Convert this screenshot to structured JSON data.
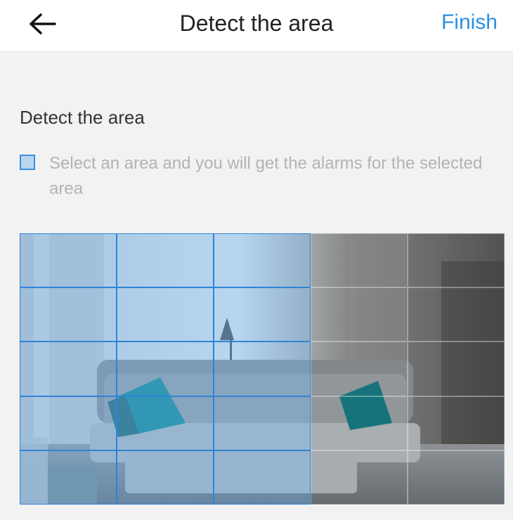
{
  "header": {
    "title": "Detect the area",
    "finish_label": "Finish",
    "back_icon": "arrow-left-icon"
  },
  "section": {
    "label": "Detect the area"
  },
  "legend": {
    "text": "Select an area and you will get the alarms for the selected area",
    "swatch_color": "#b9d6ef",
    "swatch_border": "#3a8ede"
  },
  "detection_grid": {
    "rows": 5,
    "columns": 5,
    "selected_color": "#5aaaf0",
    "cells": [
      [
        true,
        true,
        true,
        false,
        false
      ],
      [
        true,
        true,
        true,
        false,
        false
      ],
      [
        true,
        true,
        true,
        false,
        false
      ],
      [
        true,
        true,
        true,
        false,
        false
      ],
      [
        true,
        true,
        true,
        false,
        false
      ]
    ]
  }
}
